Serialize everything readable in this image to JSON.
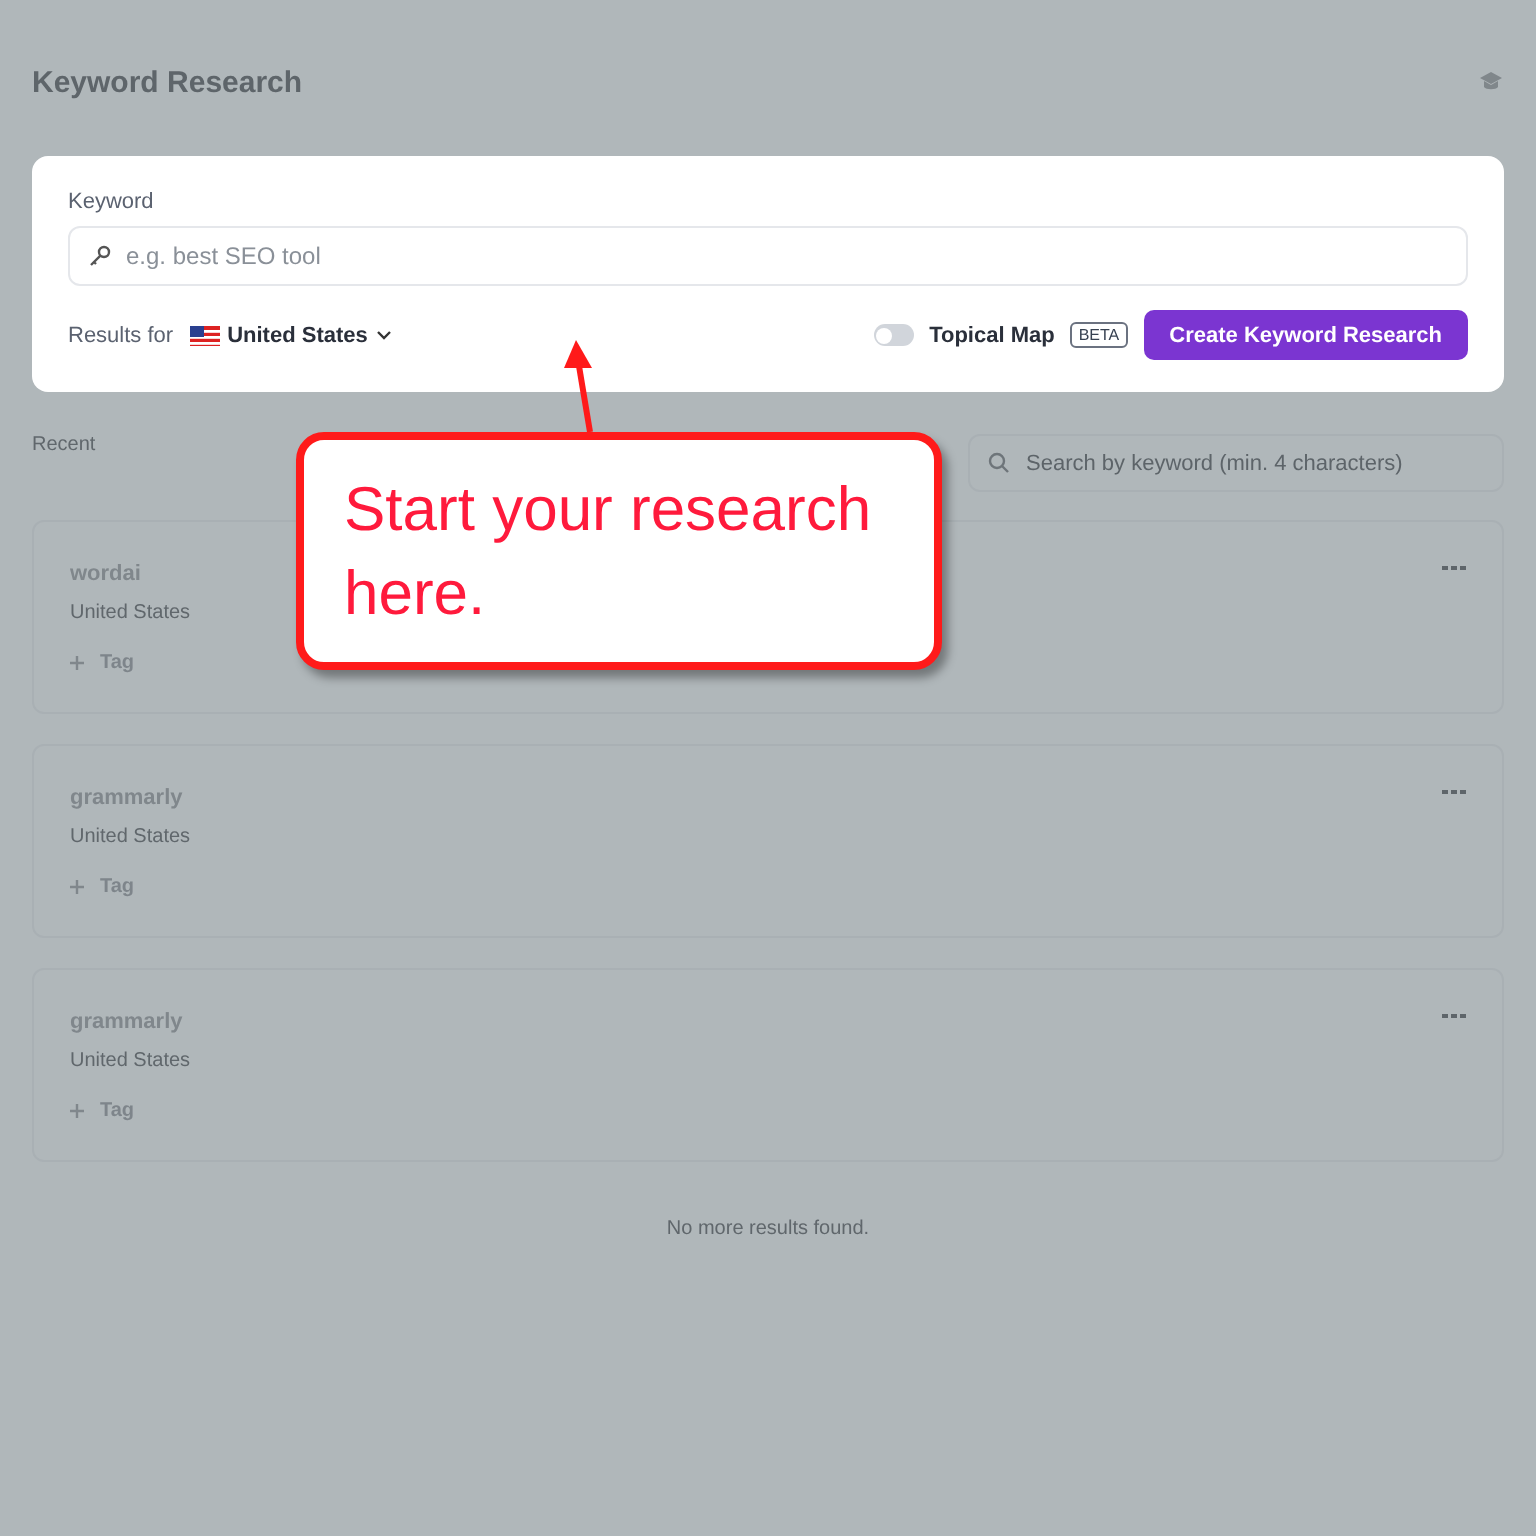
{
  "page": {
    "title": "Keyword Research"
  },
  "keyword_form": {
    "label": "Keyword",
    "placeholder": "e.g. best SEO tool",
    "results_for_label": "Results for",
    "country": "United States",
    "topical_map": {
      "label": "Topical Map",
      "on": false,
      "badge": "BETA"
    },
    "submit": "Create Keyword Research"
  },
  "recent": {
    "label": "Recent",
    "search_placeholder": "Search by keyword (min. 4 characters)",
    "items": [
      {
        "keyword": "wordai",
        "country": "United States",
        "tag_button": "Tag"
      },
      {
        "keyword": "grammarly",
        "country": "United States",
        "tag_button": "Tag"
      },
      {
        "keyword": "grammarly",
        "country": "United States",
        "tag_button": "Tag"
      }
    ],
    "end_note": "No more results found."
  },
  "callout": {
    "text": "Start your research here."
  }
}
